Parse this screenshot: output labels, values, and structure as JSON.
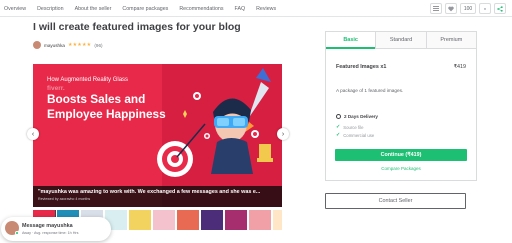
{
  "nav": {
    "links": [
      "Overview",
      "Description",
      "About the seller",
      "Compare packages",
      "Recommendations",
      "FAQ",
      "Reviews"
    ],
    "like_count": "100"
  },
  "gig": {
    "title": "I will create featured images for your blog",
    "seller_name": "mayushka",
    "stars": "★★★★★",
    "rating_count": "(96)"
  },
  "gallery": {
    "line1": "How Augmented Reality Glass",
    "watermark": "fiverr.",
    "line2": "Boosts Sales and",
    "line3": "Employee Happiness",
    "review_quote": "\"mayushka was amazing to work with. We exchanged a few messages and she was e...",
    "review_sub": "Reviewed by azoravho 4 months",
    "prev_icon": "‹",
    "next_icon": "›"
  },
  "thumbnails": {
    "colors": [
      "#e8294a",
      "#1f8fb8",
      "#d9dfe8",
      "#d8eef0",
      "#f2d35f",
      "#f3c2cd",
      "#e86a53",
      "#4c2d7a",
      "#a62d6e",
      "#f2a0a8",
      "#ffe6c7"
    ]
  },
  "package": {
    "tabs": [
      "Basic",
      "Standard",
      "Premium"
    ],
    "name": "Featured Images x1",
    "price": "₹419",
    "description": "A package of 1 featured images.",
    "delivery": "2 Days Delivery",
    "features": [
      "Source file",
      "Commercial use"
    ],
    "continue_label": "Continue (₹419)",
    "compare_label": "Compare Packages"
  },
  "contact": {
    "label": "Contact Seller"
  },
  "chat": {
    "title": "Message mayushka",
    "status": "Away · Avg. response time: 1h Hrs"
  },
  "colors": {
    "accent": "#1dbf73",
    "banner": "#e8294a",
    "star": "#ffb33e"
  }
}
